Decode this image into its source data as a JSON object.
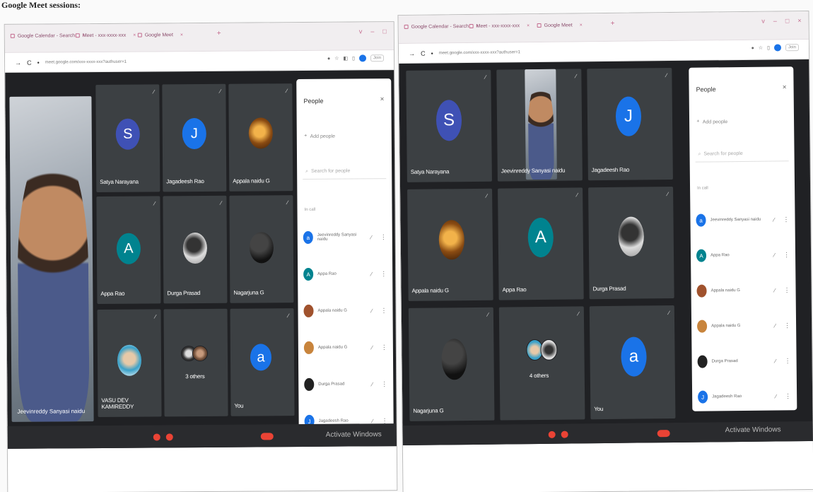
{
  "caption": "Google Meet sessions:",
  "left": {
    "tabs": [
      "Google Calendar - Search",
      "Meet - xxx-xxxx-xxx",
      "Google Meet"
    ],
    "new_tab": "+",
    "window_controls": [
      "v",
      "–",
      "□"
    ],
    "address": "meet.google.com/xxx-xxxx-xxx?authuser=1",
    "join_label": "Join",
    "presenter_name": "Jeevinreddy Sanyasi naidu",
    "tiles": [
      {
        "name": "Satya Narayana",
        "initial": "S",
        "color": "#3f51b5",
        "type": "letter"
      },
      {
        "name": "Jagadeesh Rao",
        "initial": "J",
        "color": "#1a73e8",
        "type": "letter"
      },
      {
        "name": "Appala naidu G",
        "initial": "",
        "color": "",
        "type": "fire"
      },
      {
        "name": "Appa Rao",
        "initial": "A",
        "color": "#00838f",
        "type": "letter"
      },
      {
        "name": "Durga Prasad",
        "initial": "",
        "color": "",
        "type": "durga"
      },
      {
        "name": "Nagarjuna G",
        "initial": "",
        "color": "",
        "type": "dark"
      },
      {
        "name": "VASU DEV KAMIREDDY",
        "initial": "",
        "color": "",
        "type": "kid"
      },
      {
        "name": "3 others",
        "initial": "",
        "color": "",
        "type": "pair"
      },
      {
        "name": "You",
        "initial": "a",
        "color": "#1a73e8",
        "type": "letter"
      }
    ],
    "panel": {
      "title": "People",
      "close": "×",
      "add_people": "Add people",
      "search": "Search for people",
      "section": "In call",
      "people": [
        {
          "name": "Jeevinreddy Sanyasi naidu",
          "initial": "a",
          "color": "#1a73e8"
        },
        {
          "name": "Appa Rao",
          "initial": "A",
          "color": "#00838f"
        },
        {
          "name": "Appala naidu G",
          "initial": "",
          "color": "#a0522d"
        },
        {
          "name": "Appala naidu G",
          "initial": "",
          "color": "#c8843c"
        },
        {
          "name": "Durga Prasad",
          "initial": "",
          "color": "#222222"
        },
        {
          "name": "Jagadeesh Rao",
          "initial": "J",
          "color": "#1a73e8"
        }
      ]
    },
    "activate": "Activate Windows"
  },
  "right": {
    "tabs": [
      "Google Calendar - Search",
      "Meet - xxx-xxxx-xxx",
      "Google Meet"
    ],
    "new_tab": "+",
    "window_controls": [
      "v",
      "–",
      "□",
      "×"
    ],
    "address": "meet.google.com/xxx-xxxx-xxx?authuser=1",
    "join_label": "Join",
    "tiles": [
      {
        "name": "Satya Narayana",
        "initial": "S",
        "color": "#3f51b5",
        "type": "letter"
      },
      {
        "name": "Jeevinreddy Sanyasi naidu",
        "initial": "",
        "color": "",
        "type": "video"
      },
      {
        "name": "Jagadeesh Rao",
        "initial": "J",
        "color": "#1a73e8",
        "type": "letter"
      },
      {
        "name": "Appala naidu G",
        "initial": "",
        "color": "",
        "type": "fire"
      },
      {
        "name": "Appa Rao",
        "initial": "A",
        "color": "#00838f",
        "type": "letter"
      },
      {
        "name": "Durga Prasad",
        "initial": "",
        "color": "",
        "type": "durga"
      },
      {
        "name": "Nagarjuna G",
        "initial": "",
        "color": "",
        "type": "dark"
      },
      {
        "name": "4 others",
        "initial": "",
        "color": "",
        "type": "pair"
      },
      {
        "name": "You",
        "initial": "a",
        "color": "#1a73e8",
        "type": "letter"
      }
    ],
    "panel": {
      "title": "People",
      "close": "×",
      "add_people": "Add people",
      "search": "Search for people",
      "section": "In call",
      "people": [
        {
          "name": "Jeevinreddy Sanyasi naidu",
          "initial": "a",
          "color": "#1a73e8"
        },
        {
          "name": "Appa Rao",
          "initial": "A",
          "color": "#00838f"
        },
        {
          "name": "Appala naidu G",
          "initial": "",
          "color": "#a0522d"
        },
        {
          "name": "Appala naidu G",
          "initial": "",
          "color": "#c8843c"
        },
        {
          "name": "Durga Prasad",
          "initial": "",
          "color": "#222222"
        },
        {
          "name": "Jagadeesh Rao",
          "initial": "J",
          "color": "#1a73e8"
        }
      ]
    },
    "activate": "Activate Windows"
  }
}
